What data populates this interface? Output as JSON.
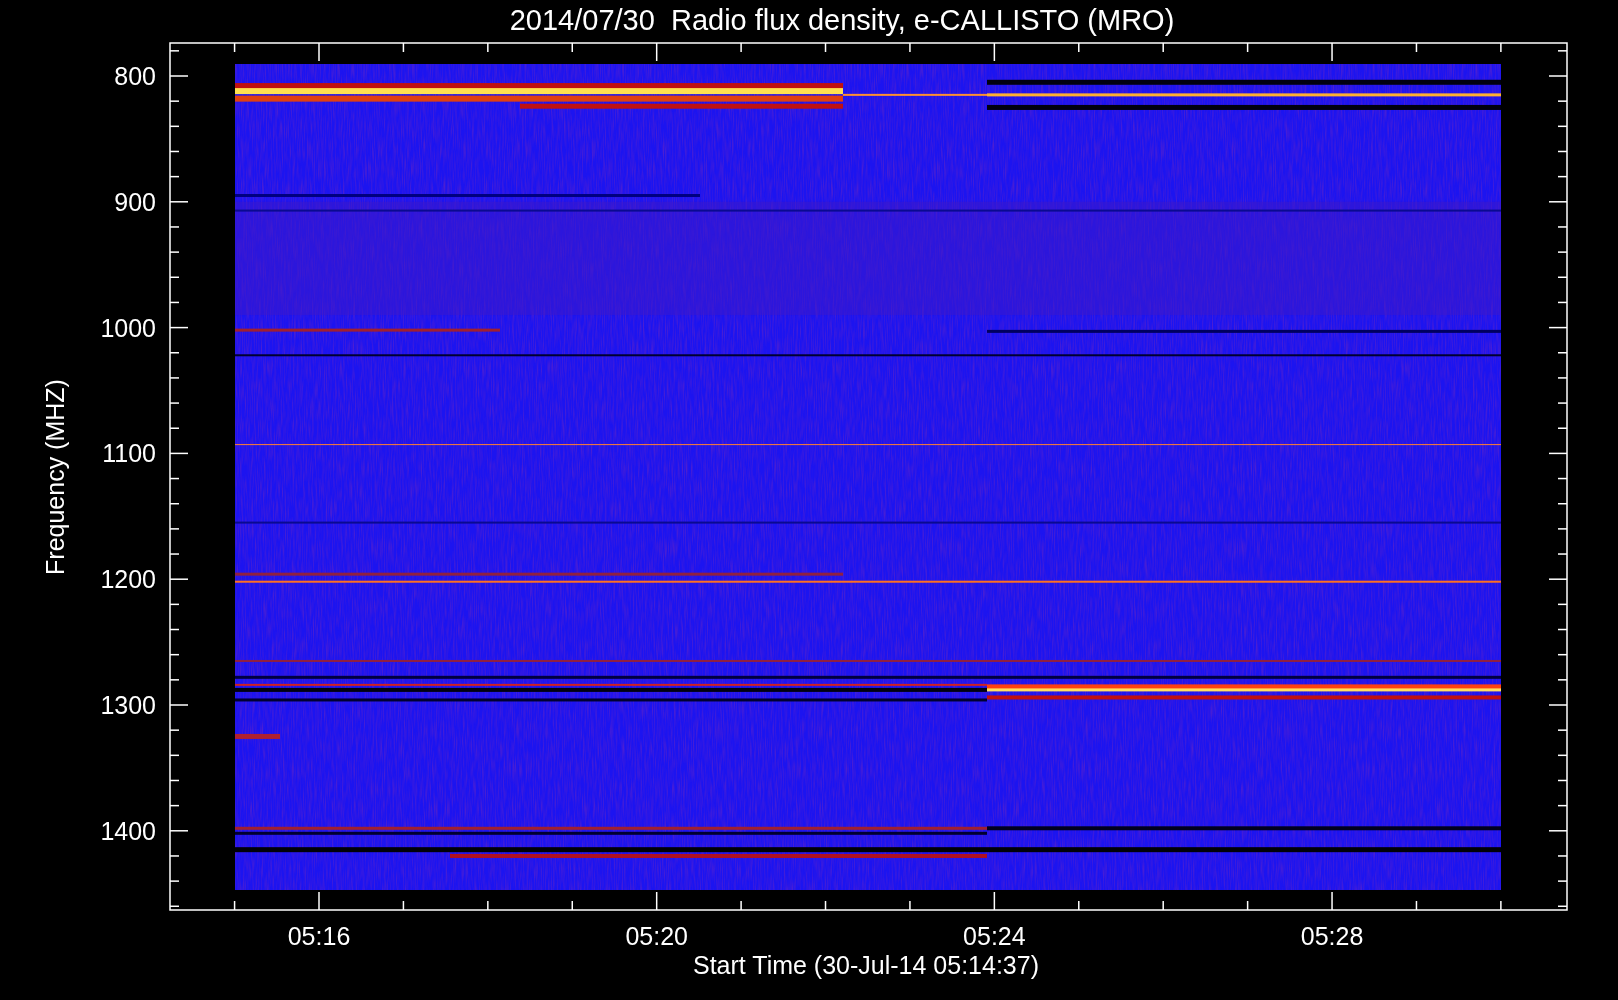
{
  "title": "2014/07/30  Radio flux density, e-CALLISTO (MRO)",
  "y_axis": {
    "label": "Frequency (MHZ)",
    "ticks": [
      "800",
      "900",
      "1000",
      "1100",
      "1200",
      "1300",
      "1400"
    ]
  },
  "x_axis": {
    "label": "Start Time (30-Jul-14 05:14:37)",
    "ticks": [
      "05:16",
      "05:20",
      "05:24",
      "05:28"
    ]
  }
}
